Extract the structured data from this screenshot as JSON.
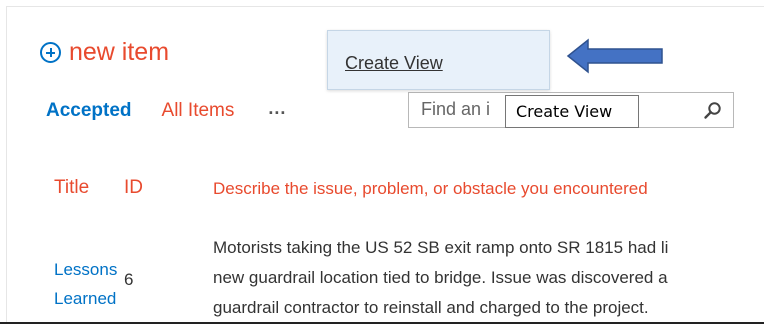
{
  "header": {
    "new_item_label": "new item"
  },
  "views": {
    "accepted": "Accepted",
    "all_items": "All Items",
    "more": "..."
  },
  "search": {
    "placeholder": "Find an i"
  },
  "dropdown": {
    "create_view": "Create View"
  },
  "tooltip": {
    "text": "Create View"
  },
  "table": {
    "columns": [
      "Title",
      "ID",
      "Describe the issue, problem, or obstacle you encountered"
    ],
    "rows": [
      {
        "title": "Lessons Learned",
        "id": "6",
        "description_lines": [
          "Motorists taking the US 52 SB exit ramp onto SR 1815 had li",
          "new guardrail location tied to bridge. Issue was discovered a",
          "guardrail contractor to reinstall and charged to the project."
        ]
      }
    ]
  },
  "colors": {
    "accent_blue": "#0072c6",
    "accent_red": "#e84a2e",
    "arrow_blue": "#4472c4",
    "dropdown_bg": "#e8f1fa"
  },
  "icons": {
    "add": "plus-circle-icon",
    "search": "search-icon",
    "arrow": "left-arrow-icon"
  }
}
